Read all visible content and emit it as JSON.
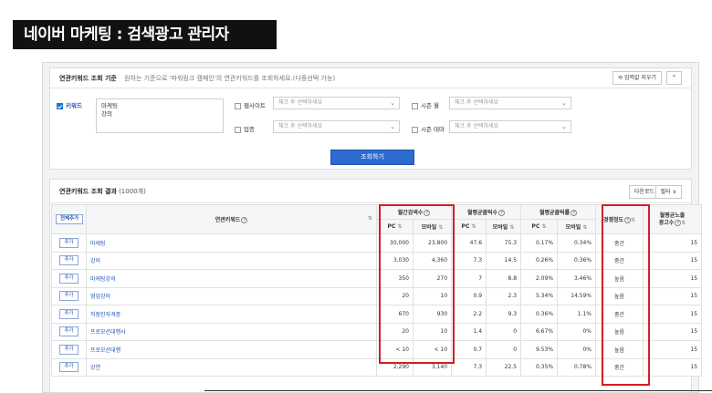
{
  "page_title": "네이버 마케팅 : 검색광고 관리자",
  "search": {
    "head_title": "연관키워드 조회 기준",
    "head_hint": "원하는 기준으로 '파워링크 캠페인'의 연관키워드를 조회하세요.(다중선택 가능)",
    "reset_label": "입력값 지우기",
    "collapse_label": "^",
    "keyword_label": "키워드",
    "keyword_value": "마케팅\n강의",
    "website_label": "웹사이트",
    "industry_label": "업종",
    "season_month_label": "시즌 월",
    "season_theme_label": "시즌 테마",
    "select_placeholder": "체크 후 선택하세요",
    "submit_label": "조회하기"
  },
  "result": {
    "head_title": "연관키워드 조회 결과",
    "count_text": "(1000개)",
    "download_label": "다운로드",
    "filter_label": "필터 ∨",
    "add_all_label": "전체추가",
    "add_label": "추가",
    "columns": {
      "keyword": "연관키워드",
      "monthly_search": "월간검색수",
      "monthly_click": "월평균클릭수",
      "monthly_ctr": "월평균클릭률",
      "competition": "경쟁정도",
      "ad_count_line1": "월평균노출",
      "ad_count_line2": "광고수",
      "pc": "PC",
      "mobile": "모바일"
    },
    "rows": [
      {
        "keyword": "마케팅",
        "s_pc": "30,000",
        "s_mo": "23,800",
        "c_pc": "47.6",
        "c_mo": "75.3",
        "r_pc": "0.17%",
        "r_mo": "0.34%",
        "comp": "중간",
        "ads": "15"
      },
      {
        "keyword": "강의",
        "s_pc": "3,030",
        "s_mo": "4,360",
        "c_pc": "7.3",
        "c_mo": "14.5",
        "r_pc": "0.26%",
        "r_mo": "0.36%",
        "comp": "중간",
        "ads": "15"
      },
      {
        "keyword": "마케팅강의",
        "s_pc": "350",
        "s_mo": "270",
        "c_pc": "7",
        "c_mo": "8.8",
        "r_pc": "2.09%",
        "r_mo": "3.46%",
        "comp": "높음",
        "ads": "15"
      },
      {
        "keyword": "영업강의",
        "s_pc": "20",
        "s_mo": "10",
        "c_pc": "0.9",
        "c_mo": "2.3",
        "r_pc": "5.34%",
        "r_mo": "14.59%",
        "comp": "높음",
        "ads": "15"
      },
      {
        "keyword": "직장인자격증",
        "s_pc": "670",
        "s_mo": "930",
        "c_pc": "2.2",
        "c_mo": "9.3",
        "r_pc": "0.36%",
        "r_mo": "1.1%",
        "comp": "중간",
        "ads": "15"
      },
      {
        "keyword": "프로모션대행사",
        "s_pc": "20",
        "s_mo": "10",
        "c_pc": "1.4",
        "c_mo": "0",
        "r_pc": "6.67%",
        "r_mo": "0%",
        "comp": "높음",
        "ads": "15"
      },
      {
        "keyword": "프로모션대행",
        "s_pc": "< 10",
        "s_mo": "< 10",
        "c_pc": "0.7",
        "c_mo": "0",
        "r_pc": "9.53%",
        "r_mo": "0%",
        "comp": "높음",
        "ads": "15"
      },
      {
        "keyword": "강연",
        "s_pc": "2,290",
        "s_mo": "3,140",
        "c_pc": "7.3",
        "c_mo": "22.5",
        "r_pc": "0.35%",
        "r_mo": "0.78%",
        "comp": "중간",
        "ads": "15"
      }
    ]
  },
  "colors": {
    "highlight": "#d21f25",
    "primary": "#2d6bd0",
    "link": "#2354b3"
  }
}
